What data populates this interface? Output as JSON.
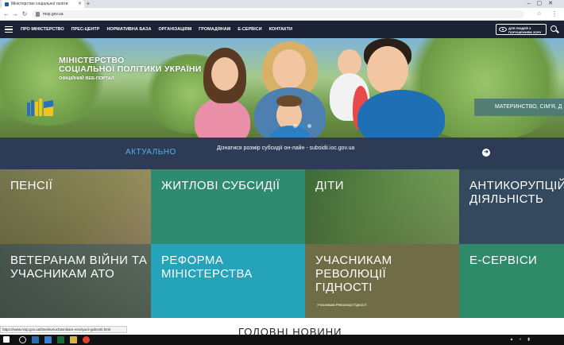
{
  "browser": {
    "tab_title": "Міністерство соціальної політи",
    "url": "msp.gov.ua",
    "status_url": "https://www.msp.gov.ua/timeline/uchasnikam-revolyucii-gidnosti.html"
  },
  "nav": {
    "items": [
      "ПРО МІНІСТЕРСТВО",
      "ПРЕС-ЦЕНТР",
      "НОРМАТИВНА БАЗА",
      "ОРГАНІЗАЦІЯМ",
      "ГРОМАДЯНАМ",
      "Е-СЕРВІСИ",
      "КОНТАКТИ"
    ],
    "vision_line1": "ДЛЯ ЛЮДЕЙ З",
    "vision_line2": "ПОРУШЕННЯМ ЗОРУ"
  },
  "hero": {
    "title_line1": "МІНІСТЕРСТВО",
    "title_line2": "СОЦІАЛЬНОЇ ПОЛІТИКИ УКРАЇНИ",
    "subtitle": "ОФІЦІЙНИЙ ВЕБ-ПОРТАЛ",
    "slide_caption": "МАТЕРИНСТВО, СІМ'Я, Д",
    "active_slide": 2,
    "slide_count": 3
  },
  "ticker": {
    "label": "АКТУАЛЬНО",
    "message": "Дізнатися розмір субсидії он-лайн - subsidii.ioc.gov.ua"
  },
  "tiles": [
    {
      "title": "ПЕНСІЇ",
      "color": "#98935c"
    },
    {
      "title": "ЖИТЛОВІ СУБСИДІЇ",
      "color": "#2e8b70"
    },
    {
      "title": "ДІТИ",
      "color": "#6c9a50"
    },
    {
      "title": "АНТИКОРУПЦІЙ ДІЯЛЬНІСТЬ",
      "color": "#34495e"
    },
    {
      "title": "ВЕТЕРАНАМ ВІЙНИ ТА УЧАСНИКАМ АТО",
      "color": "#4b5a54"
    },
    {
      "title": "РЕФОРМА МІНІСТЕРСТВА",
      "color": "#25a3b8"
    },
    {
      "title": "УЧАСНИКАМ РЕВОЛЮЦІЇ ГІДНОСТІ",
      "subtitle": "Учасникам Революції Гідності",
      "color": "#6f6c46"
    },
    {
      "title": "Е-СЕРВІСИ",
      "color": "#2f8a6a"
    }
  ],
  "bottom": {
    "heading": "ГОЛОВНІ НОВИНИ"
  }
}
